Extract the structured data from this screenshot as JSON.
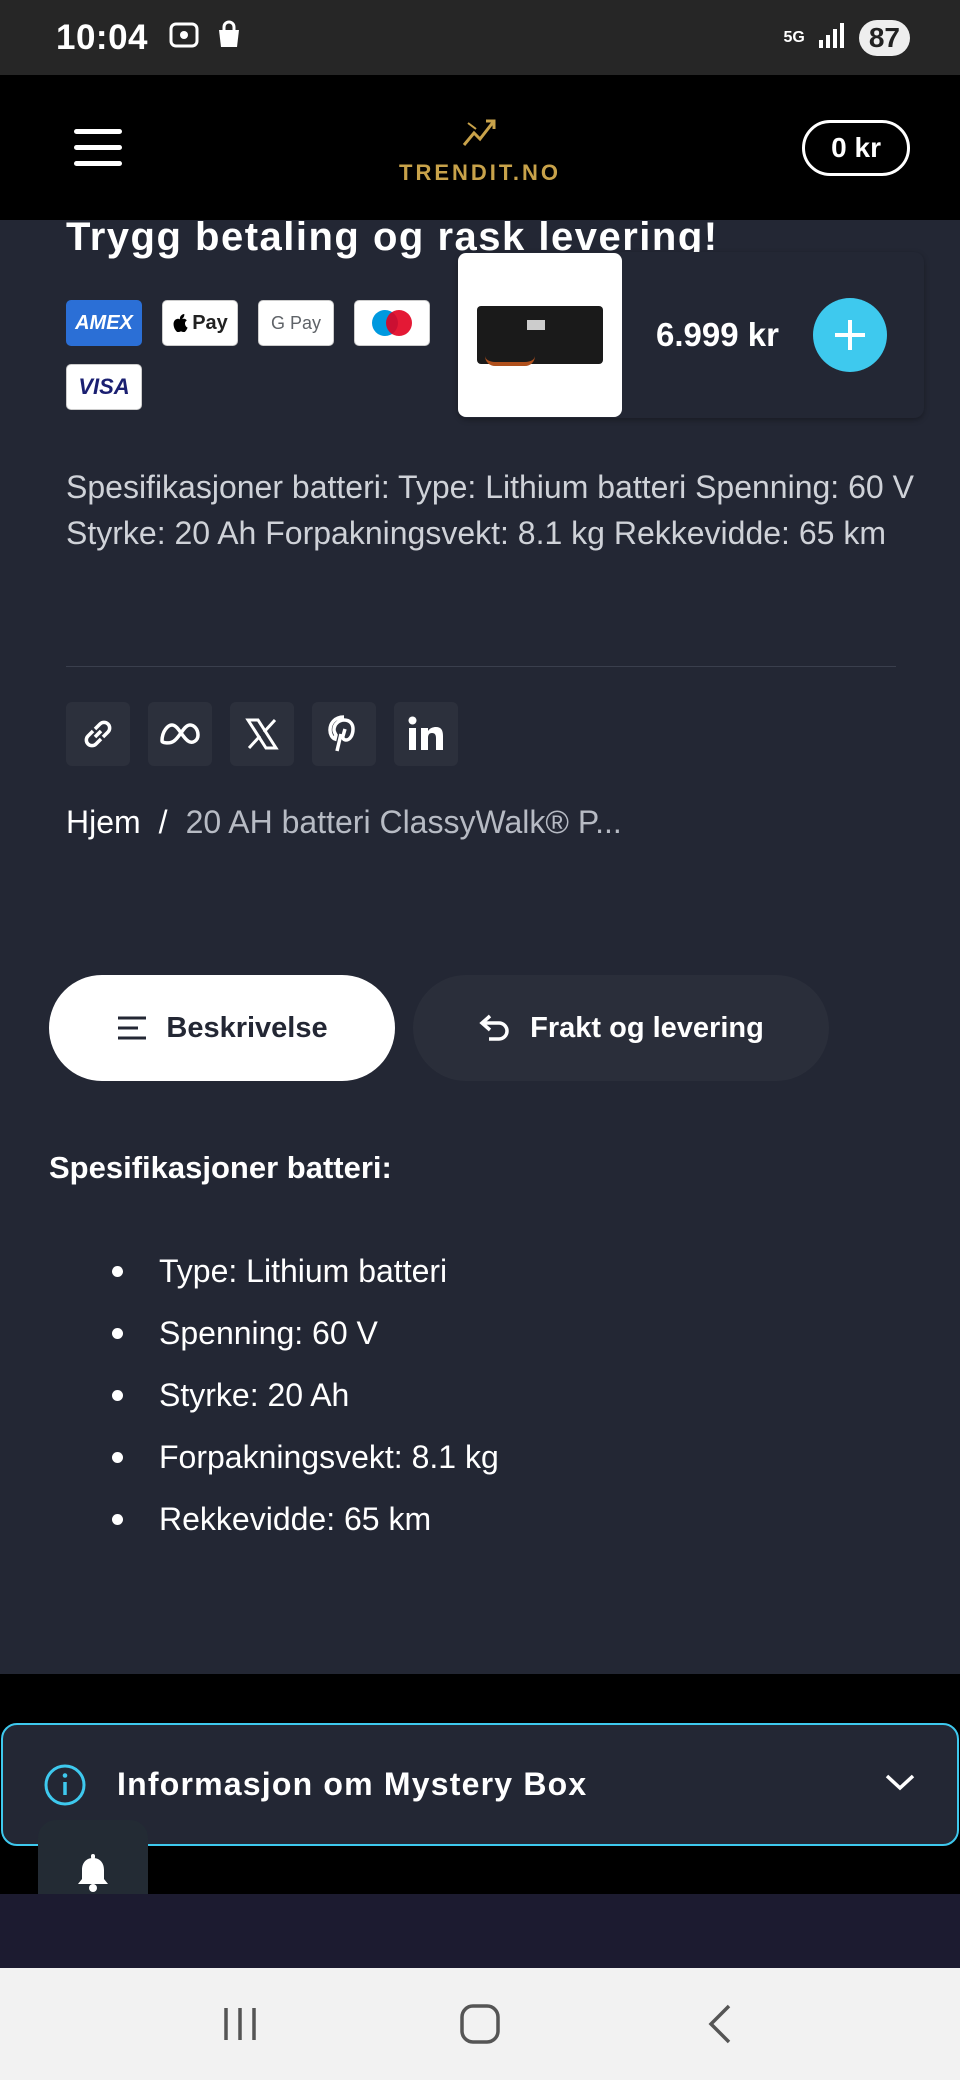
{
  "status_bar": {
    "time": "10:04",
    "network": "5G",
    "battery": "87"
  },
  "header": {
    "logo_text": "TRENDIT.NO",
    "cart_total": "0 kr"
  },
  "payment": {
    "heading": "Trygg betaling og rask levering!",
    "cards": [
      "AMEX",
      "Pay",
      "G Pay",
      "",
      "",
      "VISA"
    ]
  },
  "sticky": {
    "price": "6.999 kr"
  },
  "product": {
    "spec_text": "Spesifikasjoner batteri: Type: Lithium batteri Spenning: 60 V Styrke: 20 Ah Forpakningsvekt: 8.1 kg Rekkevidde: 65 km"
  },
  "share": [
    "link-icon",
    "meta-icon",
    "x-icon",
    "pinterest-icon",
    "linkedin-icon"
  ],
  "breadcrumb": {
    "home": "Hjem",
    "separator": "/",
    "current": "20 AH batteri ClassyWalk® P..."
  },
  "tabs": {
    "description": "Beskrivelse",
    "shipping": "Frakt og levering"
  },
  "description": {
    "heading": "Spesifikasjoner batteri:",
    "items": [
      "Type: Lithium batteri",
      "Spenning: 60 V",
      "Styrke: 20 Ah",
      "Forpakningsvekt: 8.1 kg",
      "Rekkevidde: 65 km"
    ]
  },
  "mystery": {
    "label": "Informasjon om Mystery Box"
  },
  "colors": {
    "accent": "#3ec9ee",
    "background": "#232734",
    "header": "#000000",
    "logo": "#c8a24a"
  }
}
